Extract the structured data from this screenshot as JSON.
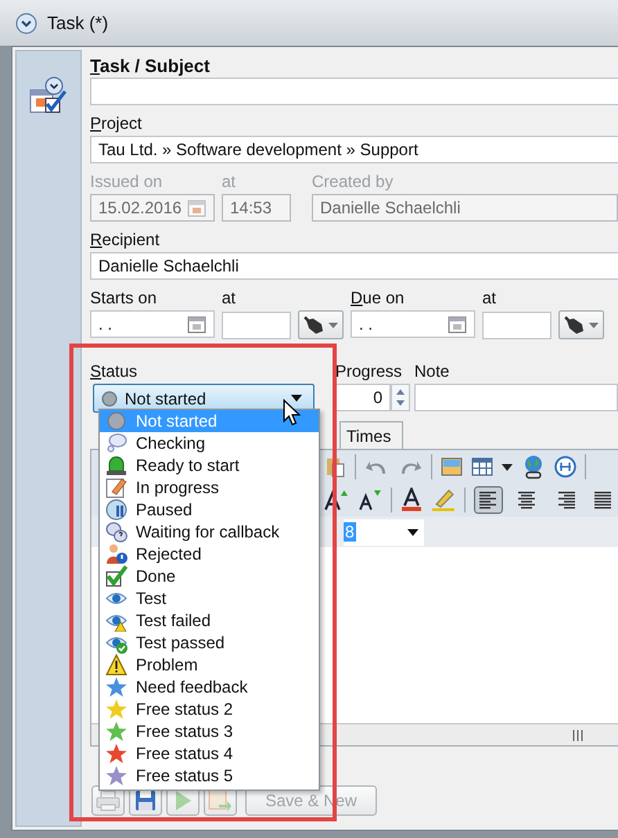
{
  "window": {
    "title": "Task (*)"
  },
  "form": {
    "subject": {
      "label": "Task / Subject",
      "mnemonic": true
    },
    "project": {
      "label": "Project",
      "mnemonic": true,
      "value": "Tau Ltd. » Software development » Support"
    },
    "issued": {
      "label": "Issued on",
      "value": "15.02.2016",
      "disabled": true
    },
    "issued_time": {
      "label": "at",
      "value": "14:53",
      "disabled": true
    },
    "created_by": {
      "label": "Created by",
      "value": "Danielle Schaelchli",
      "disabled": true
    },
    "recipient": {
      "label": "Recipient",
      "mnemonic": true,
      "value": "Danielle Schaelchli"
    },
    "starts": {
      "label": "Starts on",
      "mnemonic": false,
      "value": ". ."
    },
    "starts_time": {
      "label": "at"
    },
    "due": {
      "label": "Due on",
      "mnemonic": true,
      "value": ". ."
    },
    "due_time": {
      "label": "at"
    },
    "status": {
      "label": "Status",
      "mnemonic": true,
      "value": "Not started"
    },
    "progress": {
      "label": "Progress",
      "value": "0"
    },
    "note": {
      "label": "Note"
    }
  },
  "tabs": [
    {
      "label": "Times",
      "selected": false
    }
  ],
  "alignment": [
    {
      "kind": "left",
      "pressed": true
    },
    {
      "kind": "center",
      "pressed": false
    },
    {
      "kind": "right",
      "pressed": false
    },
    {
      "kind": "justify",
      "pressed": false
    }
  ],
  "font_size": "8",
  "buttons": [
    {
      "kind": "print",
      "disabled": true
    },
    {
      "kind": "save",
      "disabled": false
    },
    {
      "kind": "play",
      "disabled": true
    },
    {
      "kind": "export",
      "disabled": true
    },
    {
      "kind": "text",
      "label": "Save & New",
      "disabled": true
    }
  ],
  "status_menu": [
    {
      "kind": "dot",
      "label": "Not started",
      "selected": true
    },
    {
      "kind": "bubble",
      "label": "Checking",
      "selected": false
    },
    {
      "kind": "lamp",
      "label": "Ready to start",
      "selected": false
    },
    {
      "kind": "pencil",
      "label": "In progress",
      "selected": false
    },
    {
      "kind": "pause",
      "label": "Paused",
      "selected": false
    },
    {
      "kind": "question",
      "label": "Waiting for callback",
      "selected": false
    },
    {
      "kind": "person",
      "label": "Rejected",
      "selected": false
    },
    {
      "kind": "check",
      "label": "Done",
      "selected": false
    },
    {
      "kind": "eye",
      "label": "Test",
      "selected": false
    },
    {
      "kind": "eye-warning",
      "label": "Test failed",
      "selected": false
    },
    {
      "kind": "eye-check",
      "label": "Test passed",
      "selected": false
    },
    {
      "kind": "warning",
      "label": "Problem",
      "selected": false
    },
    {
      "kind": "star",
      "label": "Need feedback",
      "color": "#4a90e0",
      "selected": false
    },
    {
      "kind": "star",
      "label": "Free status 2",
      "color": "#f0cc20",
      "selected": false
    },
    {
      "kind": "star",
      "label": "Free status 3",
      "color": "#60c050",
      "selected": false
    },
    {
      "kind": "star",
      "label": "Free status 4",
      "color": "#e84830",
      "selected": false
    },
    {
      "kind": "star",
      "label": "Free status 5",
      "color": "#9890c8",
      "selected": false
    }
  ]
}
